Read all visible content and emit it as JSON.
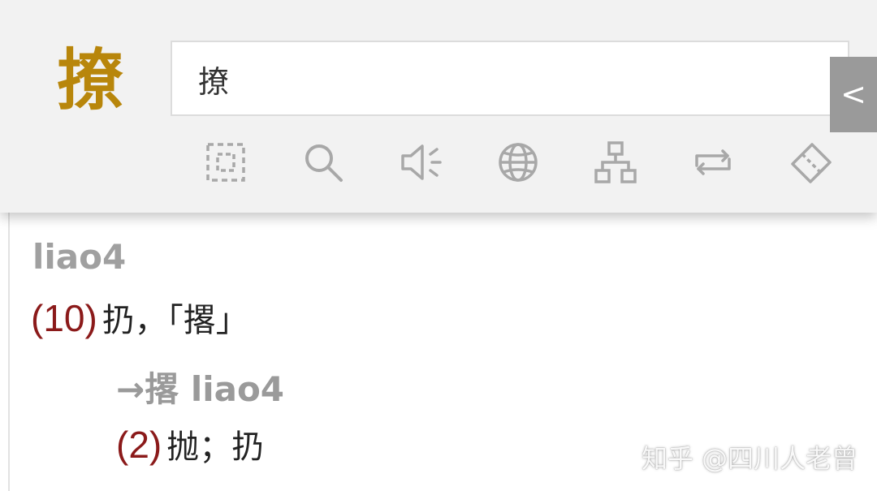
{
  "header": {
    "character": "撩",
    "search": {
      "value": "撩"
    },
    "collapse_label": "<"
  },
  "toolbar": {
    "icons": [
      "select-region-icon",
      "search-icon",
      "speaker-icon",
      "globe-icon",
      "hierarchy-icon",
      "repeat-icon",
      "eraser-icon"
    ]
  },
  "entry": {
    "pinyin": "liao4",
    "definitions": [
      {
        "number": "(10)",
        "text": "扔，「撂」"
      }
    ],
    "cross_reference": {
      "arrow_text": "→撂 liao4",
      "definitions": [
        {
          "number": "(2)",
          "text": "抛；扔"
        }
      ]
    }
  },
  "watermark": "知乎 @四川人老曾",
  "colors": {
    "accent": "#b8860b",
    "definition_number": "#8b1a1a",
    "muted_text": "#a0a0a0",
    "header_bg": "#f2f2f2"
  }
}
